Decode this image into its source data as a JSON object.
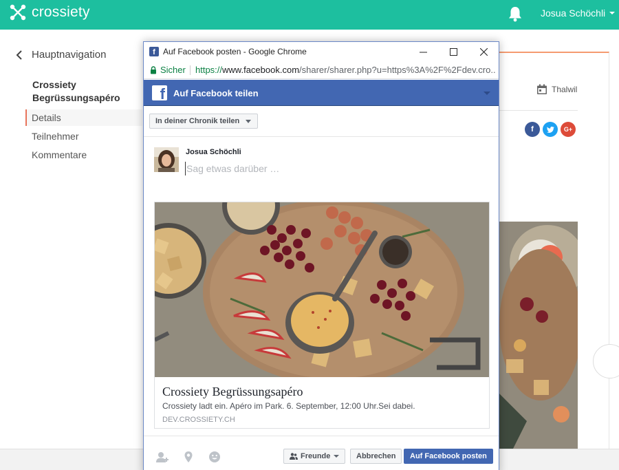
{
  "app": {
    "logo_text": "crossiety",
    "user_name": "Josua Schöchli",
    "brand_color": "#1dbf9f"
  },
  "sidebar": {
    "back_label": "Hauptnavigation",
    "event_title": "Crossiety Begrüssungsapéro",
    "items": [
      {
        "label": "Details",
        "active": true
      },
      {
        "label": "Teilnehmer",
        "active": false
      },
      {
        "label": "Kommentare",
        "active": false
      }
    ]
  },
  "content": {
    "location": "Thalwil",
    "share_icons": [
      "facebook-icon",
      "twitter-icon",
      "google-plus-icon"
    ]
  },
  "popup": {
    "window_title": "Auf Facebook posten - Google Chrome",
    "secure_label": "Sicher",
    "url_scheme": "https://",
    "url_host": "www.facebook.com",
    "url_path": "/sharer/sharer.php?u=https%3A%2F%2Fdev.cro...",
    "header_title": "Auf Facebook teilen",
    "share_target": "In deiner Chronik teilen",
    "post_user": "Josua Schöchli",
    "composer_placeholder": "Sag etwas darüber …",
    "card": {
      "title": "Crossiety Begrüssungsapéro",
      "description": "Crossiety ladt ein. Apéro im Park. 6. September, 12:00 Uhr.Sei dabei.",
      "domain": "DEV.CROSSIETY.CH"
    },
    "audience_label": "Freunde",
    "cancel_label": "Abbrechen",
    "post_label": "Auf Facebook posten",
    "fb_color": "#4267b2"
  }
}
